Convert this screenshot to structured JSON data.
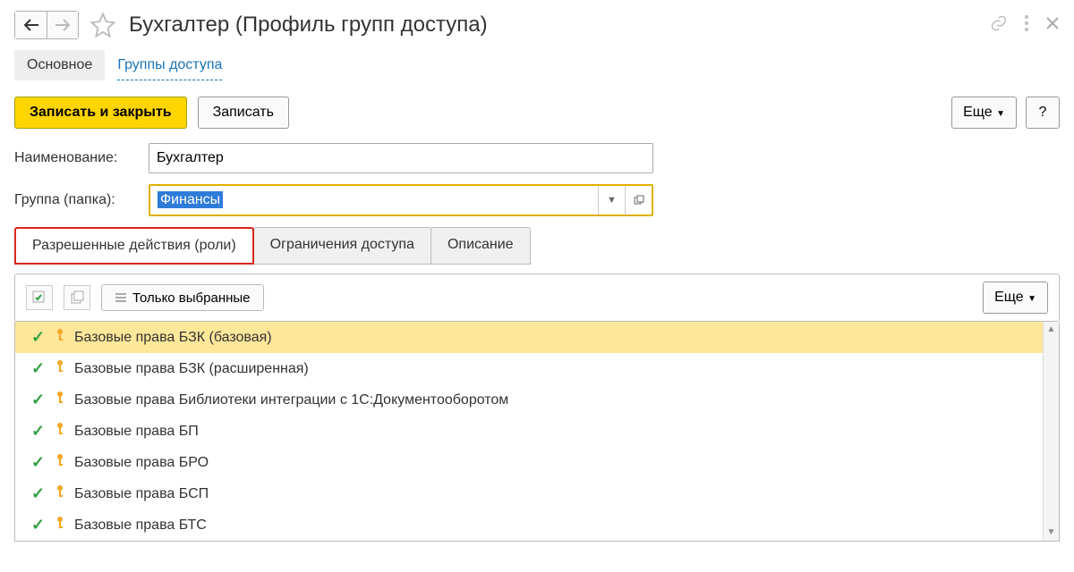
{
  "header": {
    "title": "Бухгалтер (Профиль групп доступа)"
  },
  "subnav": {
    "main_tab": "Основное",
    "groups_link": "Группы доступа"
  },
  "toolbar": {
    "save_close": "Записать и закрыть",
    "save": "Записать",
    "more": "Еще",
    "help": "?"
  },
  "form": {
    "name_label": "Наименование:",
    "name_value": "Бухгалтер",
    "group_label": "Группа (папка):",
    "group_value": "Финансы"
  },
  "tabs": {
    "roles": "Разрешенные действия (роли)",
    "restrictions": "Ограничения доступа",
    "description": "Описание"
  },
  "list_toolbar": {
    "selected_only": "Только выбранные",
    "more": "Еще"
  },
  "roles": [
    {
      "label": "Базовые права БЗК (базовая)",
      "selected": true
    },
    {
      "label": "Базовые права БЗК (расширенная)",
      "selected": false
    },
    {
      "label": "Базовые права Библиотеки интеграции с 1С:Документооборотом",
      "selected": false
    },
    {
      "label": "Базовые права БП",
      "selected": false
    },
    {
      "label": "Базовые права БРО",
      "selected": false
    },
    {
      "label": "Базовые права БСП",
      "selected": false
    },
    {
      "label": "Базовые права БТС",
      "selected": false
    }
  ]
}
